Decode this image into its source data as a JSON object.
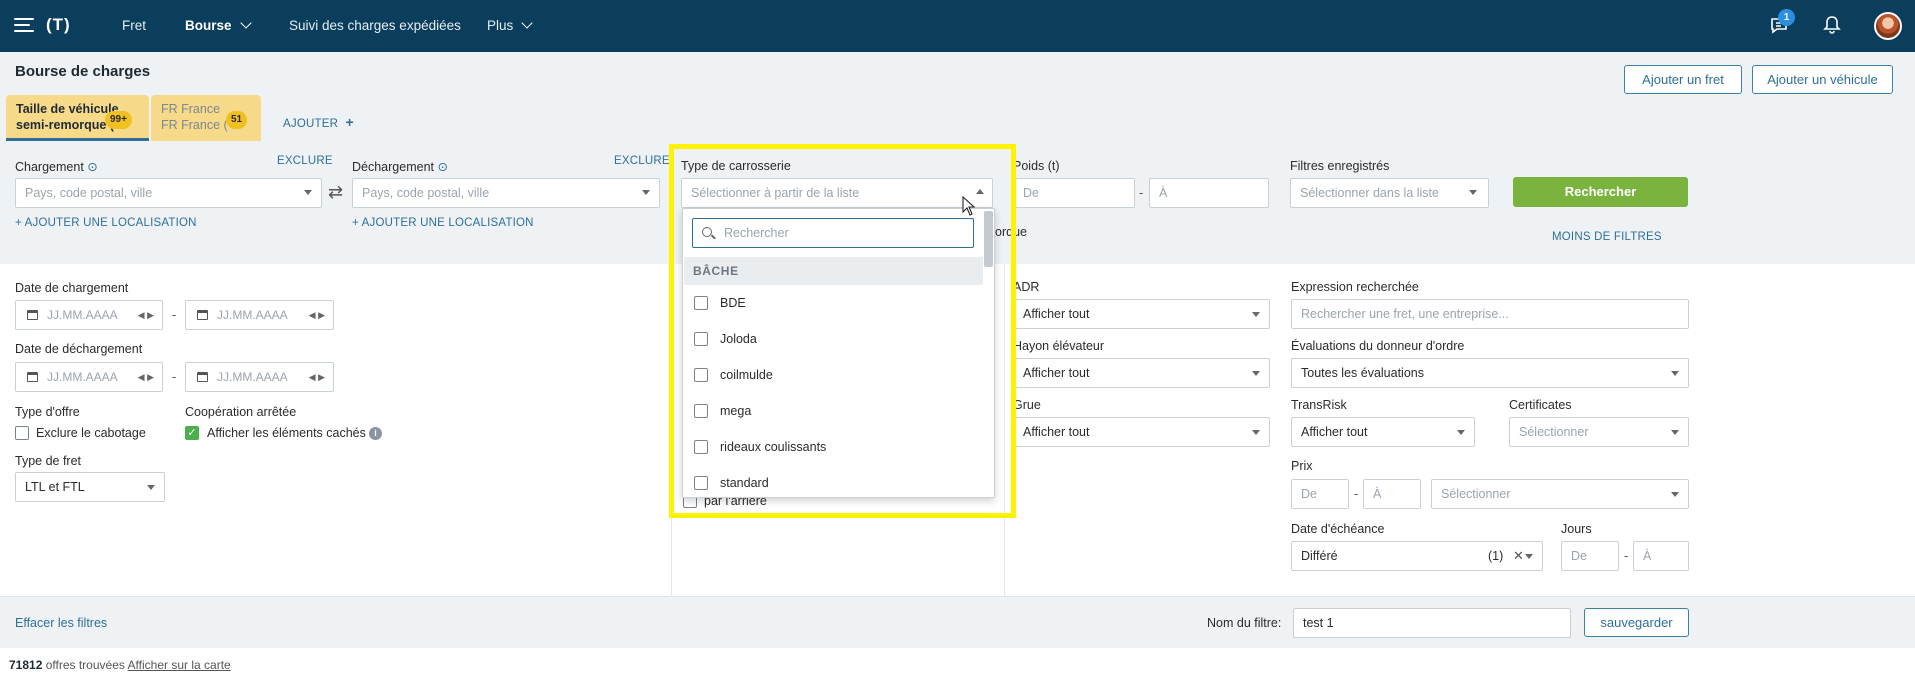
{
  "nav": {
    "items": [
      {
        "label": "Fret"
      },
      {
        "label": "Bourse"
      },
      {
        "label": "Suivi des charges expédiées"
      },
      {
        "label": "Plus"
      }
    ],
    "message_count": "1",
    "logo_text": "(T)"
  },
  "header": {
    "title": "Bourse de charges",
    "add_freight": "Ajouter un fret",
    "add_vehicle": "Ajouter un véhicule"
  },
  "tabs": [
    {
      "line1": "Taille de véhicule",
      "line2": "semi-remorque (",
      "badge": "99+"
    },
    {
      "line1": "FR France",
      "line2": "FR France (",
      "badge": "51"
    }
  ],
  "add_tab": "AJOUTER",
  "loading": {
    "label": "Chargement",
    "exclude": "EXCLURE",
    "placeholder": "Pays, code postal, ville",
    "add_location": "+ AJOUTER UNE LOCALISATION"
  },
  "unloading": {
    "label": "Déchargement",
    "exclude": "EXCLURE",
    "placeholder": "Pays, code postal, ville",
    "add_location": "+ AJOUTER UNE LOCALISATION"
  },
  "body_type": {
    "label": "Type de carrosserie",
    "placeholder": "Sélectionner à partir de la liste"
  },
  "weight": {
    "label": "Poids (t)",
    "from": "De",
    "to": "À"
  },
  "saved_filters": {
    "label": "Filtres enregistrés",
    "placeholder": "Sélectionner dans la liste"
  },
  "search_button": "Rechercher",
  "less_filters": "MOINS DE FILTRES",
  "partial_text": {
    "orque": "orque",
    "rear": "par l'arrière"
  },
  "dates": {
    "loading_label": "Date de chargement",
    "unloading_label": "Date de déchargement",
    "placeholder": "JJ.MM.AAAA",
    "dash": "-"
  },
  "offer_type": {
    "label": "Type d'offre",
    "exclude_cabotage": "Exclure le cabotage"
  },
  "cooperation": {
    "label": "Coopération arrêtée",
    "show_hidden": "Afficher les éléments cachés"
  },
  "freight_type": {
    "label": "Type de fret",
    "value": "LTL et FTL"
  },
  "adr": {
    "label": "ADR",
    "value": "Afficher tout"
  },
  "tail_lift": {
    "label": "Hayon élévateur",
    "value": "Afficher tout"
  },
  "crane": {
    "label": "Grue",
    "value": "Afficher tout"
  },
  "search_expression": {
    "label": "Expression recherchée",
    "placeholder": "Rechercher une fret, une entreprise..."
  },
  "ratings": {
    "label": "Évaluations du donneur d'ordre",
    "value": "Toutes les évaluations"
  },
  "transrisk": {
    "label": "TransRisk",
    "value": "Afficher tout"
  },
  "certificates": {
    "label": "Certificates",
    "placeholder": "Sélectionner"
  },
  "price": {
    "label": "Prix",
    "from": "De",
    "to": "À",
    "currency_placeholder": "Sélectionner"
  },
  "due_date": {
    "label": "Date d'échéance",
    "value": "Différé",
    "count": "(1)"
  },
  "days": {
    "label": "Jours",
    "from": "De",
    "to": "À"
  },
  "footer": {
    "clear_filters": "Effacer les filtres",
    "filter_name_label": "Nom du filtre:",
    "filter_name_value": "test 1",
    "save": "sauvegarder"
  },
  "status": {
    "count": "71812",
    "found": "offres trouvées",
    "show_map": "Afficher sur la carte"
  },
  "dropdown": {
    "search_placeholder": "Rechercher",
    "group": "BÂCHE",
    "items": [
      "BDE",
      "Joloda",
      "coilmulde",
      "mega",
      "rideaux coulissants",
      "standard"
    ]
  },
  "colors": {
    "nav_bg": "#0b3d5c",
    "accent": "#2f6f95",
    "green": "#7ab33e",
    "tab_bg": "#f7d98a",
    "highlight": "#fff200"
  }
}
